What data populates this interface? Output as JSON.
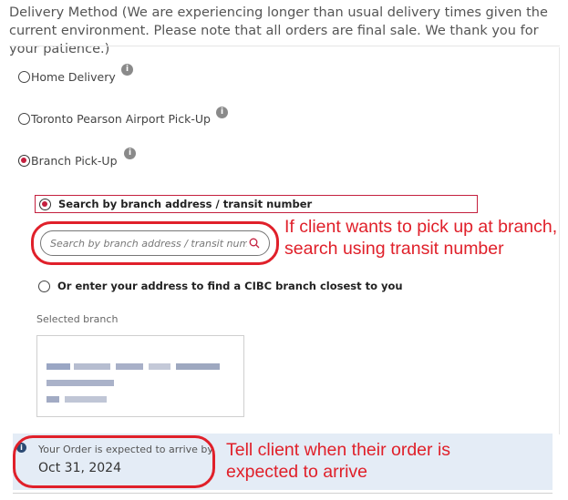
{
  "header": {
    "text": "Delivery Method (We are experiencing longer than usual delivery times given the current environment. Please note that all orders are final sale. We thank you for your patience.)"
  },
  "delivery_options": {
    "home": {
      "label": "Home Delivery",
      "checked": false
    },
    "airport": {
      "label": "Toronto Pearson Airport Pick-Up",
      "checked": false
    },
    "branch": {
      "label": "Branch Pick-Up",
      "checked": true
    }
  },
  "branch_search": {
    "search_option_label": "Search by branch address / transit number",
    "search_placeholder": "Search by branch address / transit number",
    "address_option_label": "Or enter your address to find a CIBC branch closest to you",
    "selected_branch_label": "Selected branch"
  },
  "arrival": {
    "label": "Your Order is expected to arrive by",
    "date": "Oct 31, 2024"
  },
  "annotations": {
    "search_note": "If client wants to pick up at branch, search using transit number",
    "arrival_note": "Tell client when their order is expected to arrive"
  },
  "icons": {
    "info": "info-icon",
    "search": "magnifier-icon"
  },
  "colors": {
    "accent_red": "#c41f3e",
    "annotation_red": "#e0202a",
    "arrival_bg": "#e4ecf6"
  }
}
